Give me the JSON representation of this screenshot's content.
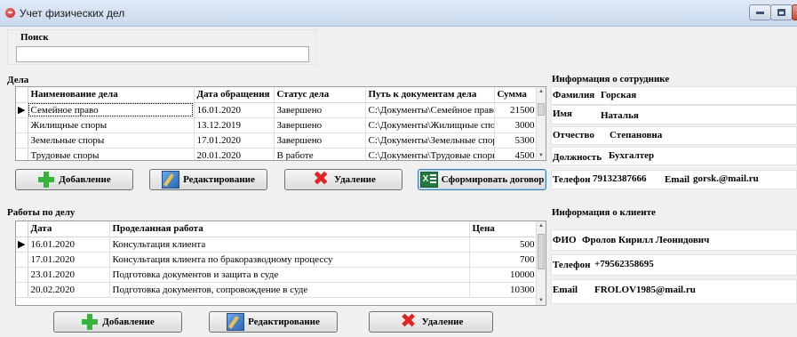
{
  "window": {
    "title": "Учет физических дел",
    "close_glyph": "×"
  },
  "search": {
    "label": "Поиск",
    "value": ""
  },
  "cases": {
    "label": "Дела",
    "columns": [
      "Наименование дела",
      "Дата обращения",
      "Статус дела",
      "Путь к документам дела",
      "Сумма"
    ],
    "rows": [
      {
        "name": "Семейное право",
        "date": "16.01.2020",
        "status": "Завершено",
        "path": "C:\\Документы\\Семейное право\\",
        "sum": "21500"
      },
      {
        "name": "Жилищные споры",
        "date": "13.12.2019",
        "status": "Завершено",
        "path": "C:\\Документы\\Жилищные споры",
        "sum": "3000"
      },
      {
        "name": "Земельные споры",
        "date": "17.01.2020",
        "status": "Завершено",
        "path": "C:\\Документы\\Земельные споры",
        "sum": "5300"
      },
      {
        "name": "Трудовые споры",
        "date": "20.01.2020",
        "status": "В работе",
        "path": "C:\\Документы\\Трудовые споры",
        "sum": "4500"
      }
    ],
    "current_row_marker": "▶"
  },
  "case_buttons": {
    "add": "Добавление",
    "edit": "Редактирование",
    "delete": "Удаление",
    "report": "Сформировать договор",
    "excel_glyph": "X"
  },
  "works": {
    "label": "Работы по делу",
    "columns": [
      "Дата",
      "Проделанная работа",
      "Цена"
    ],
    "rows": [
      {
        "date": "16.01.2020",
        "work": "Консультация клиента",
        "price": "500"
      },
      {
        "date": "17.01.2020",
        "work": "Консультация клиента по бракоразводному процессу",
        "price": "700"
      },
      {
        "date": "23.01.2020",
        "work": "Подготовка документов и защита в суде",
        "price": "10000"
      },
      {
        "date": "20.02.2020",
        "work": "Подготовка документов, сопровождение в суде",
        "price": "10300"
      }
    ],
    "current_row_marker": "▶"
  },
  "work_buttons": {
    "add": "Добавление",
    "edit": "Редактирование",
    "delete": "Удаление"
  },
  "employee": {
    "label": "Информация о сотруднике",
    "surname_label": "Фамилия",
    "surname": "Горская",
    "name_label": "Имя",
    "name": "Наталья",
    "patronymic_label": "Отчество",
    "patronymic": "Степановна",
    "position_label": "Должность",
    "position": "Бухгалтер",
    "phone_label": "Телефон",
    "phone": "79132387666",
    "email_label": "Email",
    "email": "gorsk.@mail.ru"
  },
  "client": {
    "label": "Информация о клиенте",
    "fio_label": "ФИО",
    "fio": "Фролов Кирилл Леонидович",
    "phone_label": "Телефон",
    "phone": "+79562358695",
    "email_label": "Email",
    "email": "FROLOV1985@mail.ru"
  },
  "scroll": {
    "up": "▲",
    "down": "▼"
  },
  "icons": [
    "app-icon",
    "plus-icon",
    "edit-icon",
    "delete-cross-icon",
    "excel-icon"
  ],
  "colors": {
    "add_green": "#36b53c",
    "delete_red": "#e32222",
    "excel_green": "#1f7b3e"
  }
}
